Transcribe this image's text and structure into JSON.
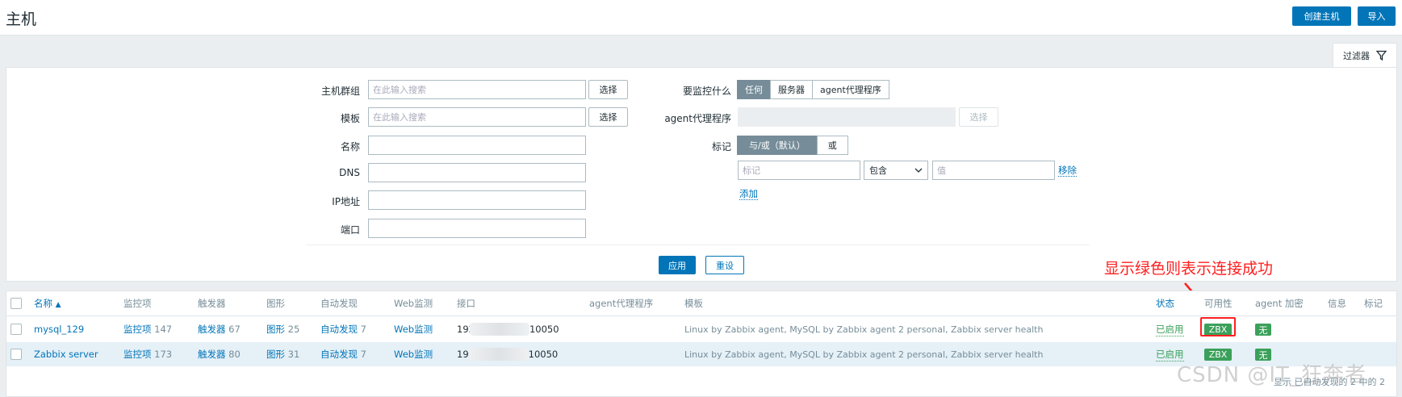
{
  "header": {
    "title": "主机",
    "create_button": "创建主机",
    "import_button": "导入"
  },
  "filter": {
    "tab_label": "过滤器",
    "host_group": {
      "label": "主机群组",
      "placeholder": "在此输入搜索",
      "select_button": "选择"
    },
    "template": {
      "label": "模板",
      "placeholder": "在此输入搜索",
      "select_button": "选择"
    },
    "name": {
      "label": "名称",
      "value": ""
    },
    "dns": {
      "label": "DNS",
      "value": ""
    },
    "ip": {
      "label": "IP地址",
      "value": ""
    },
    "port": {
      "label": "端口",
      "value": ""
    },
    "monitored_by": {
      "label": "要监控什么",
      "options": [
        "任何",
        "服务器",
        "agent代理程序"
      ],
      "selected": "任何"
    },
    "proxy": {
      "label": "agent代理程序",
      "select_button": "选择"
    },
    "tags": {
      "label": "标记",
      "options": [
        "与/或（默认）",
        "或"
      ],
      "selected": "与/或（默认）",
      "tag_placeholder": "标记",
      "operator": "包含",
      "value_placeholder": "值",
      "remove_link": "移除",
      "add_link": "添加"
    },
    "apply_button": "应用",
    "reset_button": "重设"
  },
  "annotation": "显示绿色则表示连接成功",
  "table": {
    "headers": {
      "name": "名称",
      "items": "监控项",
      "triggers": "触发器",
      "graphs": "图形",
      "discovery": "自动发现",
      "web": "Web监测",
      "interface": "接口",
      "proxy": "agent代理程序",
      "templates": "模板",
      "status": "状态",
      "availability": "可用性",
      "encryption": "agent 加密",
      "info": "信息",
      "tags": "标记"
    },
    "sort_arrow": "▲",
    "rows": [
      {
        "name": "mysql_129",
        "items": "监控项",
        "items_count": "147",
        "triggers": "触发器",
        "triggers_count": "67",
        "graphs": "图形",
        "graphs_count": "25",
        "discovery": "自动发现",
        "discovery_count": "7",
        "web": "Web监测",
        "interface_prefix": "192",
        "interface_suffix": "10050",
        "templates": "Linux by Zabbix agent, MySQL by Zabbix agent 2 personal, Zabbix server health",
        "status": "已启用",
        "availability": "ZBX",
        "encryption": "无"
      },
      {
        "name": "Zabbix server",
        "items": "监控项",
        "items_count": "173",
        "triggers": "触发器",
        "triggers_count": "80",
        "graphs": "图形",
        "graphs_count": "31",
        "discovery": "自动发现",
        "discovery_count": "7",
        "web": "Web监测",
        "interface_prefix": "19",
        "interface_suffix": "10050",
        "templates": "Linux by Zabbix agent, MySQL by Zabbix agent 2 personal, Zabbix server health",
        "status": "已启用",
        "availability": "ZBX",
        "encryption": "无"
      }
    ],
    "footer": "显示 已自动发现的 2 中的 2"
  },
  "watermark": "CSDN @IT_狂奔者",
  "colors": {
    "primary": "#0275b8",
    "success": "#3ba05a",
    "annotation": "#ff1f1f",
    "row_highlight": "#e5f0f7"
  }
}
